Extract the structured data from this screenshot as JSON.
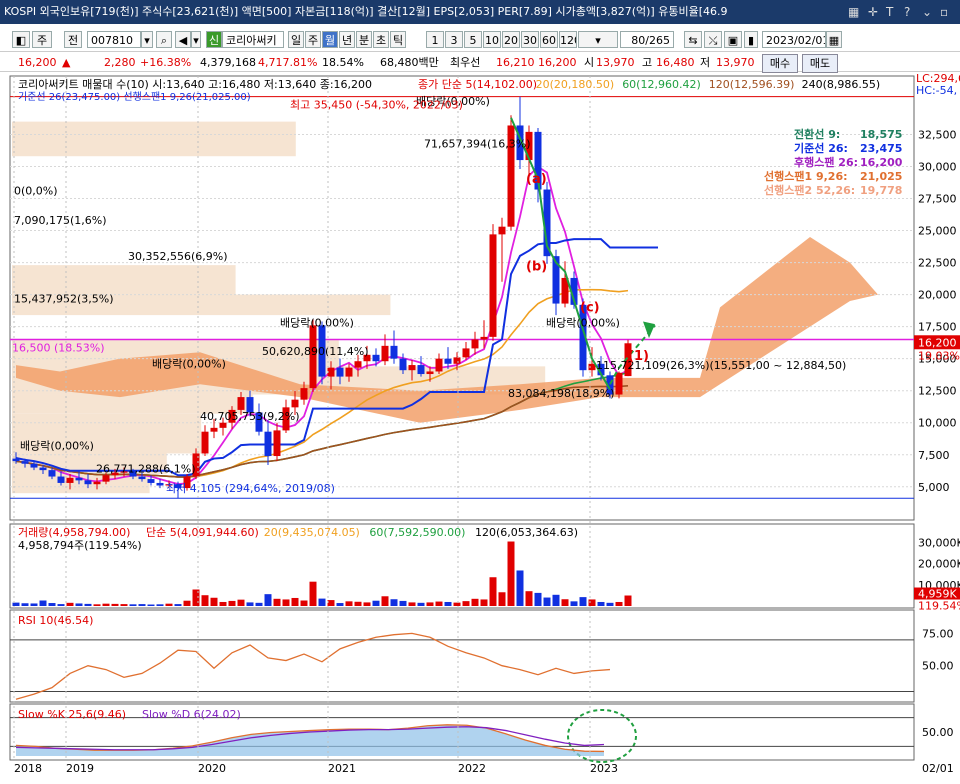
{
  "ticker": "KOSPI 외국인보유[719(천)] 주식수[23,621(천)] 액면[500] 자본금[118(억)] 결산[12월] EPS[2,053] PER[7.89] 시가총액[3,827(억)] 유통비율[46.9",
  "toolbar": {
    "period": "주",
    "all_label": "전",
    "code": "007810",
    "shin_label": "신",
    "name": "코리아써키",
    "tabs": [
      "일",
      "주",
      "월",
      "년",
      "분",
      "초",
      "틱"
    ],
    "selected_tab": "월",
    "counts": [
      "1",
      "3",
      "5",
      "10",
      "20",
      "30",
      "60",
      "120"
    ],
    "range": "80/265",
    "date": "2023/02/01",
    "buy": "매수",
    "sell": "매도"
  },
  "pricebar": {
    "price": "16,200",
    "arrow": "▲",
    "change": "2,280",
    "pct": "+16.38%",
    "volume": "4,379,168",
    "volpct": "4,717.81%",
    "volratio": "18.54%",
    "amount": "68,480백만",
    "pref_label": "최우선",
    "pref1": "16,210",
    "pref2": "16,200",
    "low_label": "시",
    "low_val": "13,970",
    "high_label": "고",
    "high_val": "16,480",
    "close_label": "저",
    "close_val": "13,970"
  },
  "chart_data": [
    {
      "type": "candlestick",
      "title": "코리아써키트 매물대 수(10)  시:13,640 고:16,480 저:13,640 종:16,200",
      "legend": [
        "종가 단순 5(14,102.00)",
        "20(20,180.50)",
        "60(12,960.42)",
        "120(12,596.39)",
        "240(8,986.55)"
      ],
      "legend2": "기준선 26(23,475.00)    선행스팬1 9,26(21,025.00)",
      "right_legend": [
        {
          "label": "전환선 9:",
          "value": "18,575"
        },
        {
          "label": "기준선 26:",
          "value": "23,475"
        },
        {
          "label": "후행스팬 26:",
          "value": "16,200"
        },
        {
          "label": "선행스팬1 9,26:",
          "value": "21,025"
        },
        {
          "label": "선행스팬2 52,26:",
          "value": "19,778"
        }
      ],
      "x_labels": [
        "2018",
        "2019",
        "2020",
        "2021",
        "2022",
        "2023"
      ],
      "y_ticks": [
        "32,500",
        "30,000",
        "27,500",
        "25,000",
        "22,500",
        "20,000",
        "17,500",
        "15,000",
        "12,500",
        "10,000",
        "7,500",
        "5,000"
      ],
      "ylim": [
        3500,
        35500
      ],
      "lc": "LC:294,6",
      "hc": "HC:-54,",
      "current_price": "16,200",
      "current_pct": "19.03%",
      "horizontal_line": "16,500 (18.53%)",
      "max_label": "최고 35,450 (-54,30%, 2022/03)",
      "min_label": "최저 4,105 (294,64%, 2019/08)",
      "volume_profile_labels": [
        "0(0,0%)",
        "7,090,175(1,6%)",
        "30,352,556(6,9%)",
        "15,437,952(3,5%)",
        "71,657,394(16,3%)",
        "50,620,890(11,4%)",
        "40,705,753(9,2%)",
        "26,771,288(6,1%)",
        "83,084,198(18,9%)",
        "115,721,109(26,3%)(15,551,00 ~ 12,884,50)"
      ],
      "dividend_labels": [
        "배당락(0,00%)",
        "배당락(0,00%)",
        "배당락(0,00%)",
        "배당락(0,00%)",
        "배당락(0,00%)"
      ],
      "annotations": [
        "(a)",
        "(b)",
        "(c)",
        "(1)"
      ],
      "candles": [
        {
          "o": 7200,
          "h": 7700,
          "l": 6800,
          "c": 7000
        },
        {
          "o": 7000,
          "h": 7200,
          "l": 6500,
          "c": 6800
        },
        {
          "o": 6800,
          "h": 7000,
          "l": 6300,
          "c": 6500
        },
        {
          "o": 6500,
          "h": 6700,
          "l": 6000,
          "c": 6300
        },
        {
          "o": 6300,
          "h": 6500,
          "l": 5600,
          "c": 5800
        },
        {
          "o": 5800,
          "h": 6200,
          "l": 5100,
          "c": 5300
        },
        {
          "o": 5300,
          "h": 6000,
          "l": 4800,
          "c": 5700
        },
        {
          "o": 5700,
          "h": 6300,
          "l": 5200,
          "c": 5500
        },
        {
          "o": 5500,
          "h": 6000,
          "l": 4900,
          "c": 5200
        },
        {
          "o": 5200,
          "h": 5700,
          "l": 4800,
          "c": 5400
        },
        {
          "o": 5400,
          "h": 6100,
          "l": 5200,
          "c": 5900
        },
        {
          "o": 5900,
          "h": 6400,
          "l": 5600,
          "c": 6100
        },
        {
          "o": 6100,
          "h": 6500,
          "l": 5800,
          "c": 6200
        },
        {
          "o": 6200,
          "h": 6400,
          "l": 5600,
          "c": 5800
        },
        {
          "o": 5800,
          "h": 6100,
          "l": 5400,
          "c": 5600
        },
        {
          "o": 5600,
          "h": 5900,
          "l": 5100,
          "c": 5300
        },
        {
          "o": 5300,
          "h": 5600,
          "l": 4900,
          "c": 5100
        },
        {
          "o": 5100,
          "h": 5500,
          "l": 4900,
          "c": 5200
        },
        {
          "o": 5200,
          "h": 5400,
          "l": 4105,
          "c": 4900
        },
        {
          "o": 4900,
          "h": 6000,
          "l": 4700,
          "c": 5800
        },
        {
          "o": 5800,
          "h": 8000,
          "l": 5600,
          "c": 7600
        },
        {
          "o": 7600,
          "h": 9800,
          "l": 7400,
          "c": 9300
        },
        {
          "o": 9300,
          "h": 10300,
          "l": 8800,
          "c": 9600
        },
        {
          "o": 9600,
          "h": 10400,
          "l": 9000,
          "c": 10000
        },
        {
          "o": 10000,
          "h": 11300,
          "l": 9500,
          "c": 11000
        },
        {
          "o": 11000,
          "h": 12400,
          "l": 10600,
          "c": 12000
        },
        {
          "o": 12000,
          "h": 12500,
          "l": 10500,
          "c": 10800
        },
        {
          "o": 10800,
          "h": 11500,
          "l": 9000,
          "c": 9300
        },
        {
          "o": 9300,
          "h": 10200,
          "l": 6700,
          "c": 7400
        },
        {
          "o": 7400,
          "h": 10000,
          "l": 7000,
          "c": 9400
        },
        {
          "o": 9400,
          "h": 11800,
          "l": 9200,
          "c": 11200
        },
        {
          "o": 11200,
          "h": 12500,
          "l": 10600,
          "c": 11800
        },
        {
          "o": 11800,
          "h": 13200,
          "l": 11400,
          "c": 12700
        },
        {
          "o": 12700,
          "h": 18100,
          "l": 12400,
          "c": 17600
        },
        {
          "o": 17600,
          "h": 17900,
          "l": 13000,
          "c": 13600
        },
        {
          "o": 13600,
          "h": 14800,
          "l": 12600,
          "c": 14300
        },
        {
          "o": 14300,
          "h": 15000,
          "l": 13000,
          "c": 13600
        },
        {
          "o": 13600,
          "h": 14600,
          "l": 13200,
          "c": 14300
        },
        {
          "o": 14300,
          "h": 15300,
          "l": 13600,
          "c": 14800
        },
        {
          "o": 14800,
          "h": 16000,
          "l": 14200,
          "c": 15300
        },
        {
          "o": 15300,
          "h": 15800,
          "l": 14400,
          "c": 14800
        },
        {
          "o": 14800,
          "h": 16900,
          "l": 14500,
          "c": 16000
        },
        {
          "o": 16000,
          "h": 17200,
          "l": 14600,
          "c": 15000
        },
        {
          "o": 15000,
          "h": 15400,
          "l": 13800,
          "c": 14100
        },
        {
          "o": 14100,
          "h": 14900,
          "l": 13300,
          "c": 14500
        },
        {
          "o": 14500,
          "h": 15200,
          "l": 13600,
          "c": 13800
        },
        {
          "o": 13800,
          "h": 14400,
          "l": 13200,
          "c": 14000
        },
        {
          "o": 14000,
          "h": 15400,
          "l": 13800,
          "c": 15000
        },
        {
          "o": 15000,
          "h": 15900,
          "l": 14200,
          "c": 14600
        },
        {
          "o": 14600,
          "h": 15500,
          "l": 14100,
          "c": 15100
        },
        {
          "o": 15100,
          "h": 16300,
          "l": 14900,
          "c": 15800
        },
        {
          "o": 15800,
          "h": 17100,
          "l": 15300,
          "c": 16500
        },
        {
          "o": 16500,
          "h": 18000,
          "l": 15800,
          "c": 16700
        },
        {
          "o": 16700,
          "h": 25500,
          "l": 16400,
          "c": 24700
        },
        {
          "o": 24700,
          "h": 26000,
          "l": 21000,
          "c": 25300
        },
        {
          "o": 25300,
          "h": 34000,
          "l": 25000,
          "c": 33200
        },
        {
          "o": 33200,
          "h": 35450,
          "l": 29800,
          "c": 30500
        },
        {
          "o": 30500,
          "h": 33200,
          "l": 29300,
          "c": 32700
        },
        {
          "o": 32700,
          "h": 33000,
          "l": 27200,
          "c": 28200
        },
        {
          "o": 28200,
          "h": 28800,
          "l": 22400,
          "c": 23000
        },
        {
          "o": 23000,
          "h": 23500,
          "l": 18400,
          "c": 19300
        },
        {
          "o": 19300,
          "h": 22600,
          "l": 19000,
          "c": 21300
        },
        {
          "o": 21300,
          "h": 21800,
          "l": 18900,
          "c": 19200
        },
        {
          "o": 19200,
          "h": 19700,
          "l": 13600,
          "c": 14100
        },
        {
          "o": 14100,
          "h": 15900,
          "l": 13600,
          "c": 14600
        },
        {
          "o": 14600,
          "h": 15200,
          "l": 13300,
          "c": 13700
        },
        {
          "o": 13700,
          "h": 14000,
          "l": 11900,
          "c": 12200
        },
        {
          "o": 12200,
          "h": 14000,
          "l": 11900,
          "c": 13900
        },
        {
          "o": 13640,
          "h": 16480,
          "l": 13640,
          "c": 16200
        }
      ],
      "ma_lines": {
        "ma5_color": "#e020e0",
        "ma20_color": "#f0a020",
        "ma60_color": "#20a040",
        "ma120_color": "#a05020",
        "kijun_color": "#1030e0"
      }
    },
    {
      "type": "bar",
      "title": "거래량(4,958,794.00)",
      "legend": [
        "단순 5(4,091,944.60)",
        "20(9,435,074.05)",
        "60(7,592,590.00)",
        "120(6,053,364.63)"
      ],
      "sub_label": "4,958,794주(119.54%)",
      "y_ticks": [
        "30,000K",
        "20,000K",
        "10,000K"
      ],
      "right_tags": [
        "4,959K",
        "119.54%"
      ],
      "values": [
        1.6,
        1.3,
        1.2,
        2.6,
        1.4,
        0.9,
        1.5,
        1.2,
        1.0,
        0.8,
        1.1,
        1.0,
        0.9,
        0.8,
        0.9,
        0.7,
        0.8,
        1.1,
        0.9,
        2.5,
        7.8,
        5.1,
        3.9,
        1.9,
        2.4,
        3.0,
        1.7,
        1.5,
        5.6,
        3.4,
        3.1,
        3.8,
        2.6,
        11.5,
        3.5,
        2.8,
        1.4,
        2.2,
        2.0,
        1.7,
        2.5,
        4.6,
        3.2,
        2.4,
        1.7,
        1.5,
        1.7,
        2.1,
        1.9,
        1.6,
        2.3,
        3.4,
        3.1,
        13.6,
        6.5,
        30.5,
        16.8,
        7.0,
        6.2,
        4.0,
        5.3,
        3.2,
        2.2,
        4.2,
        3.1,
        1.9,
        1.5,
        1.9,
        4.96
      ]
    },
    {
      "type": "line",
      "title": "RSI 10(46.54)",
      "y_ticks": [
        "75.00",
        "50.00"
      ],
      "ylim": [
        25,
        90
      ],
      "values": [
        24,
        28,
        33,
        44,
        50,
        47,
        41,
        44,
        52,
        62,
        61,
        48,
        60,
        66,
        56,
        54,
        59,
        53,
        63,
        68,
        72,
        74,
        75,
        72,
        65,
        60,
        56,
        50,
        47,
        43,
        48,
        44,
        46,
        47
      ]
    },
    {
      "type": "line",
      "title": "Slow %K 25,6(9.46)",
      "title2": "Slow %D 6(24.02)",
      "y_ticks": [
        "50.00"
      ],
      "ylim": [
        0,
        100
      ],
      "k_values": [
        22,
        20,
        16,
        14,
        12,
        12,
        12,
        13,
        16,
        21,
        29,
        38,
        45,
        49,
        51,
        53,
        55,
        56,
        56,
        55,
        58,
        63,
        65,
        64,
        58,
        46,
        33,
        22,
        14,
        10,
        9.46
      ],
      "d_values": [
        18,
        17,
        16,
        15,
        14,
        13,
        13,
        13,
        15,
        18,
        24,
        31,
        38,
        43,
        47,
        50,
        52,
        54,
        55,
        55,
        56,
        58,
        60,
        61,
        59,
        53,
        44,
        35,
        27,
        22,
        24.02
      ]
    }
  ],
  "time_axis": [
    "2018",
    "2019",
    "2020",
    "2021",
    "2022",
    "2023"
  ],
  "time_axis_right": "02/01"
}
